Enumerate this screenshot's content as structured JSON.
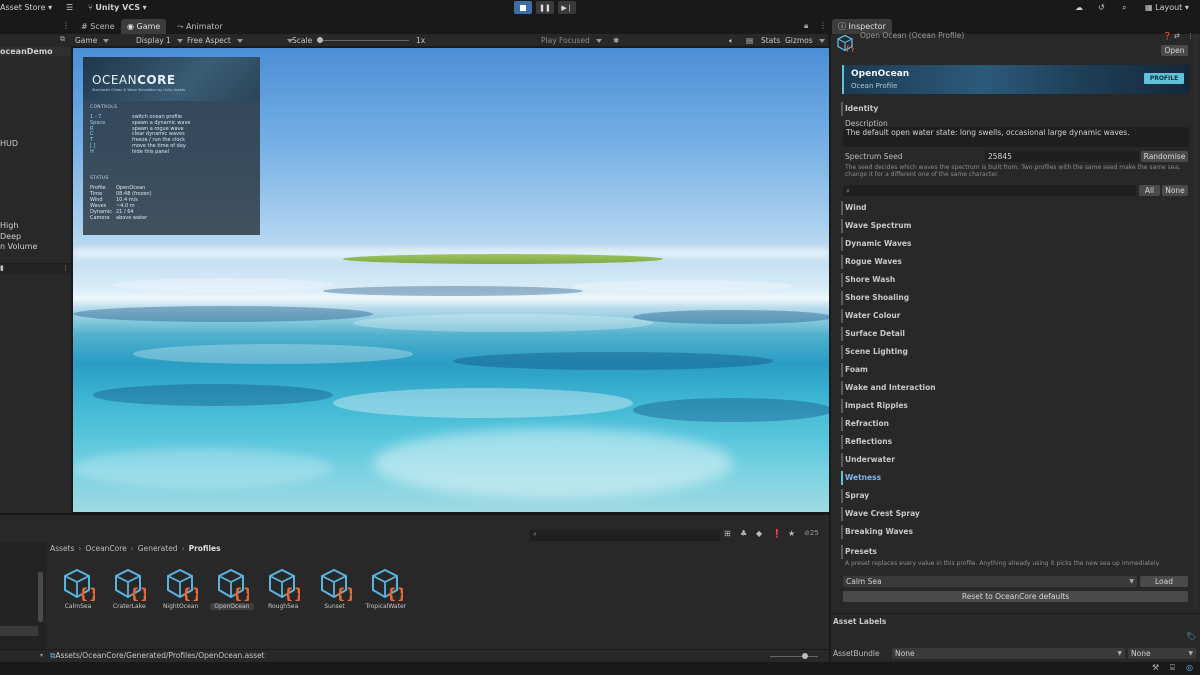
{
  "topbar": {
    "asset_store": "Asset Store",
    "vcs": "Unity VCS",
    "layout": "Layout"
  },
  "hierarchy": {
    "items": [
      "oceanDemo",
      "HUD",
      "High",
      "Deep",
      "n Volume"
    ]
  },
  "view_tabs": [
    "Scene",
    "Game",
    "Animator"
  ],
  "game_toolbar": {
    "mode": "Game",
    "display": "Display 1",
    "aspect": "Free Aspect",
    "scale_label": "Scale",
    "scale_value": "1x",
    "play_focused": "Play Focused",
    "stats": "Stats",
    "gizmos": "Gizmos"
  },
  "hud": {
    "logo_light": "OCEAN",
    "logo_bold": "CORE",
    "subtitle": "Stochastic Ocean & Wave Simulation by Unity Assets",
    "controls_heading": "CONTROLS",
    "controls": [
      {
        "key": "1 - 7",
        "action": "switch ocean profile"
      },
      {
        "key": "Space",
        "action": "spawn a dynamic wave"
      },
      {
        "key": "R",
        "action": "spawn a rogue wave"
      },
      {
        "key": "C",
        "action": "clear dynamic waves"
      },
      {
        "key": "T",
        "action": "freeze / run the clock"
      },
      {
        "key": "[ ]",
        "action": "move the time of day"
      },
      {
        "key": "H",
        "action": "hide this panel"
      }
    ],
    "status_heading": "STATUS",
    "status": [
      {
        "label": "Profile",
        "value": "OpenOcean"
      },
      {
        "label": "Time",
        "value": "08:48  (frozen)"
      },
      {
        "label": "Wind",
        "value": "10.4 m/s"
      },
      {
        "label": "Waves",
        "value": "~4.0 m"
      },
      {
        "label": "Dynamic",
        "value": "21 / 64"
      },
      {
        "label": "Camera",
        "value": "above water"
      }
    ]
  },
  "project": {
    "breadcrumb": [
      "Assets",
      "OceanCore",
      "Generated",
      "Profiles"
    ],
    "count": "25",
    "assets": [
      "CalmSea",
      "CraterLake",
      "NightOcean",
      "OpenOcean",
      "RoughSea",
      "Sunset",
      "TropicalWater"
    ],
    "selected": "OpenOcean",
    "path": "Assets/OceanCore/Generated/Profiles/OpenOcean.asset"
  },
  "inspector": {
    "tab": "Inspector",
    "header_title": "Open Ocean (Ocean Profile)",
    "open_button": "Open",
    "banner_title": "OpenOcean",
    "banner_subtitle": "Ocean Profile",
    "banner_badge": "PROFILE",
    "identity_heading": "Identity",
    "description_label": "Description",
    "description_value": "The default open water state: long swells, occasional large dynamic waves.",
    "seed_label": "Spectrum Seed",
    "seed_value": "25845",
    "randomise": "Randomise",
    "seed_help_1": "The seed decides which waves the spectrum is built from. Two profiles with the same seed make the same sea;",
    "seed_help_2": "change it for a different one of the same character.",
    "all": "All",
    "none": "None",
    "sections": [
      "Wind",
      "Wave Spectrum",
      "Dynamic Waves",
      "Rogue Waves",
      "Shore Wash",
      "Shore Shoaling",
      "Water Colour",
      "Surface Detail",
      "Scene Lighting",
      "Foam",
      "Wake and Interaction",
      "Impact Ripples",
      "Refraction",
      "Reflections",
      "Underwater",
      "Wetness",
      "Spray",
      "Wave Crest Spray",
      "Breaking Waves"
    ],
    "highlighted_section": "Wetness",
    "presets_heading": "Presets",
    "presets_help": "A preset replaces every value in this profile. Anything already using it picks the new sea up immediately.",
    "preset_value": "Calm Sea",
    "load": "Load",
    "reset": "Reset to OceanCore defaults",
    "asset_labels": "Asset Labels",
    "asset_bundle_label": "AssetBundle",
    "asset_bundle_value": "None",
    "asset_variant_value": "None"
  },
  "colors": {
    "accent": "#5fc2d8",
    "play_active": "#3d6ea8",
    "asset_icon": "#5ab4e0",
    "asset_braces": "#e46a3a"
  }
}
